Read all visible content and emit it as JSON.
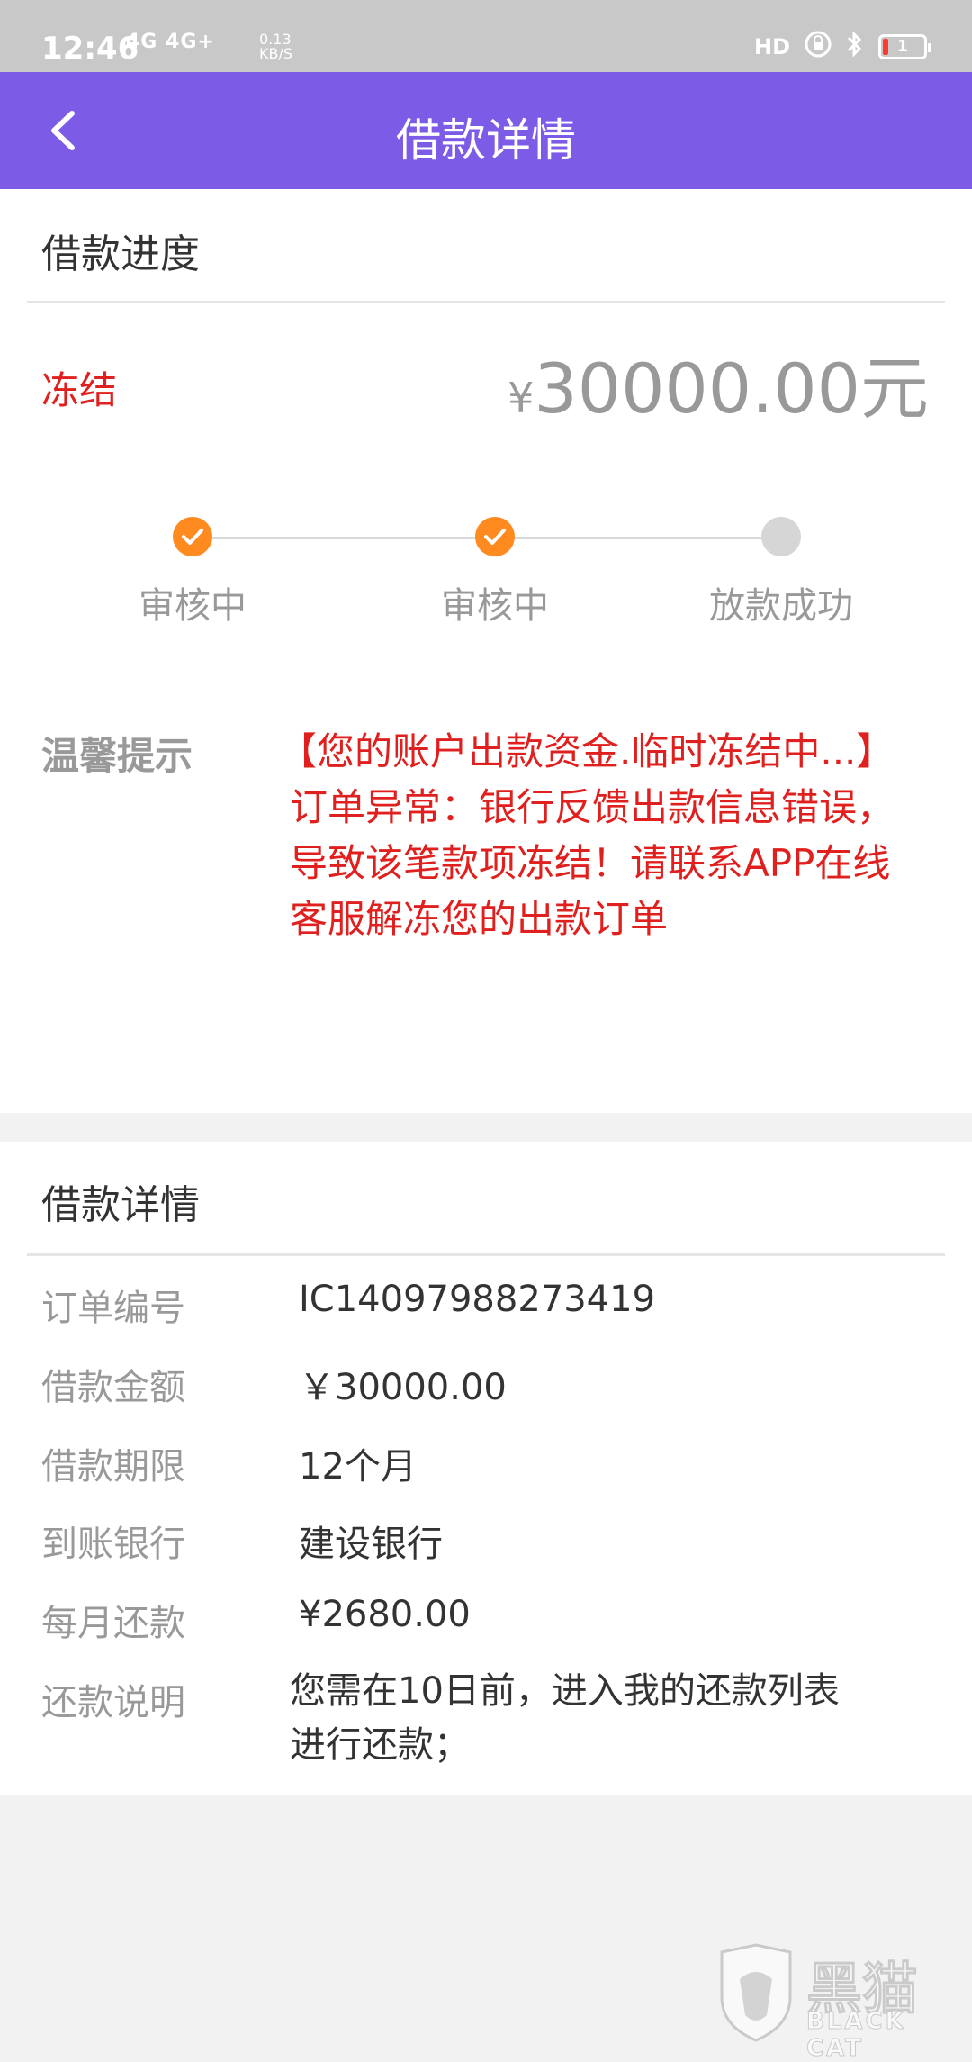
{
  "status_bar": {
    "time": "12:46",
    "signal": "4G 4G+",
    "speed_value": "0.13",
    "speed_unit": "KB/S",
    "hd": "HD",
    "battery": "1"
  },
  "nav": {
    "title": "借款详情"
  },
  "progress_card": {
    "title": "借款进度",
    "status": "冻结",
    "amount_symbol": "¥",
    "amount": "30000.00元",
    "steps": [
      {
        "label": "审核中",
        "state": "done"
      },
      {
        "label": "审核中",
        "state": "done"
      },
      {
        "label": "放款成功",
        "state": "pending"
      }
    ],
    "tip_label": "温馨提示",
    "tip_lines": [
      "【您的账户出款资金.临时冻结中...】",
      "订单异常：银行反馈出款信息错误，",
      "导致该笔款项冻结！请联系APP在线",
      "客服解冻您的出款订单"
    ]
  },
  "detail_card": {
    "title": "借款详情",
    "rows": [
      {
        "label": "订单编号",
        "value": "IC14097988273419"
      },
      {
        "label": "借款金额",
        "value": "￥30000.00"
      },
      {
        "label": "借款期限",
        "value": "12个月"
      },
      {
        "label": "到账银行",
        "value": "建设银行"
      },
      {
        "label": "每月还款",
        "value": "¥2680.00"
      }
    ],
    "note_label": "还款说明",
    "note_lines": [
      "您需在10日前，进入我的还款列表",
      "进行还款；"
    ]
  },
  "watermark": {
    "cn": "黑猫",
    "en": "BLACK CAT"
  },
  "colors": {
    "nav": "#7c5ce6",
    "accent_red": "#e0201e",
    "step_done": "#ff8a1f"
  }
}
